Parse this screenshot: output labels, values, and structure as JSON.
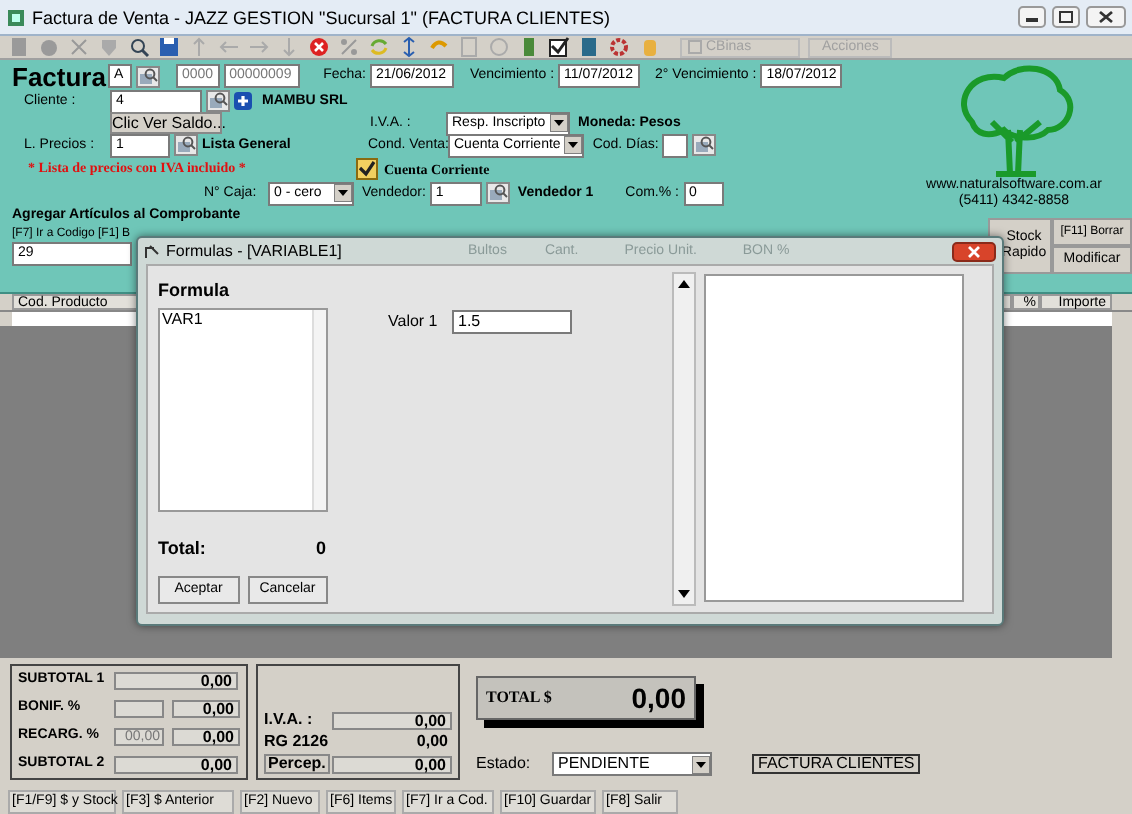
{
  "window": {
    "title": "Factura de Venta - JAZZ GESTION \"Sucursal 1\" (FACTURA CLIENTES)"
  },
  "toolbar": {
    "checkbox_label": "CBinas",
    "checked": false,
    "actions_button": "Acciones"
  },
  "header": {
    "title": "Factura",
    "letter": "A",
    "branch": "0000",
    "number": "00000009",
    "date_label": "Fecha:",
    "date": "21/06/2012",
    "due_label": "Vencimiento :",
    "due": "11/07/2012",
    "due2_label": "2° Vencimiento :",
    "due2": "18/07/2012"
  },
  "client": {
    "label": "Cliente :",
    "code": "4",
    "name": "MAMBU SRL",
    "balance_button": "Clic Ver Saldo..."
  },
  "iva": {
    "label": "I.V.A. :",
    "value": "Resp. Inscripto",
    "currency": "Moneda: Pesos"
  },
  "price_list": {
    "label": "L. Precios :",
    "code": "1",
    "name": "Lista General",
    "note": "* Lista de precios con IVA incluido *"
  },
  "sale_terms": {
    "label": "Cond. Venta:",
    "value": "Cuenta Corriente",
    "days_label": "Cod. Días:"
  },
  "current_account": {
    "label": "Cuenta Corriente",
    "checked": true
  },
  "cash": {
    "label": "N° Caja:",
    "value": "0 - cero"
  },
  "seller": {
    "label": "Vendedor:",
    "code": "1",
    "name": "Vendedor 1",
    "commission_label": "Com.% :",
    "commission": "0"
  },
  "company": {
    "url": "www.naturalsoftware.com.ar",
    "phone": "(5411) 4342-8858"
  },
  "add_items": {
    "title": "Agregar Artículos al Comprobante",
    "hint": "[F7] Ir a Codigo [F1] B",
    "code": "29"
  },
  "side_buttons": [
    "Stock Rapido",
    "[F11] Borrar",
    "Modificar"
  ],
  "table": {
    "columns": [
      "Cod. Producto",
      "%",
      "Importe"
    ]
  },
  "dialog": {
    "title": "Formulas  - [VARIABLE1]",
    "behind_headers": [
      "Bultos",
      "Cant.",
      "Precio Unit.",
      "BON %"
    ],
    "section": "Formula",
    "list_items": [
      "VAR1"
    ],
    "fields": [
      {
        "label": "Valor 1",
        "value": "1.5"
      }
    ],
    "total_label": "Total:",
    "total_value": "0",
    "buttons": [
      "Aceptar",
      "Cancelar"
    ]
  },
  "totals_left": [
    {
      "label": "SUBTOTAL 1",
      "kind": "single",
      "value": "0,00"
    },
    {
      "label": "BONIF. %",
      "kind": "pair",
      "value": "0,00"
    },
    {
      "label": "RECARG. %",
      "kind": "pair",
      "percent": "00,00",
      "value": "0,00"
    },
    {
      "label": "SUBTOTAL 2",
      "kind": "single",
      "value": "0,00"
    }
  ],
  "totals_right": [
    {
      "label": "I.V.A. :",
      "kind": "boxed",
      "value": "0,00"
    },
    {
      "label": "RG 2126",
      "kind": "plain",
      "value": "0,00"
    },
    {
      "label": "Percep.",
      "kind": "button",
      "value": "0,00"
    }
  ],
  "total": {
    "label": "TOTAL $",
    "value": "0,00"
  },
  "status": {
    "label": "Estado:",
    "value": "PENDIENTE",
    "document": "FACTURA CLIENTES"
  },
  "status_bar": [
    "[F1/F9] $ y Stock",
    "[F3] $ Anterior",
    "[F2] Nuevo",
    "[F6] Items",
    "[F7] Ir a Cod.",
    "[F10] Guardar",
    "[F8] Salir"
  ]
}
